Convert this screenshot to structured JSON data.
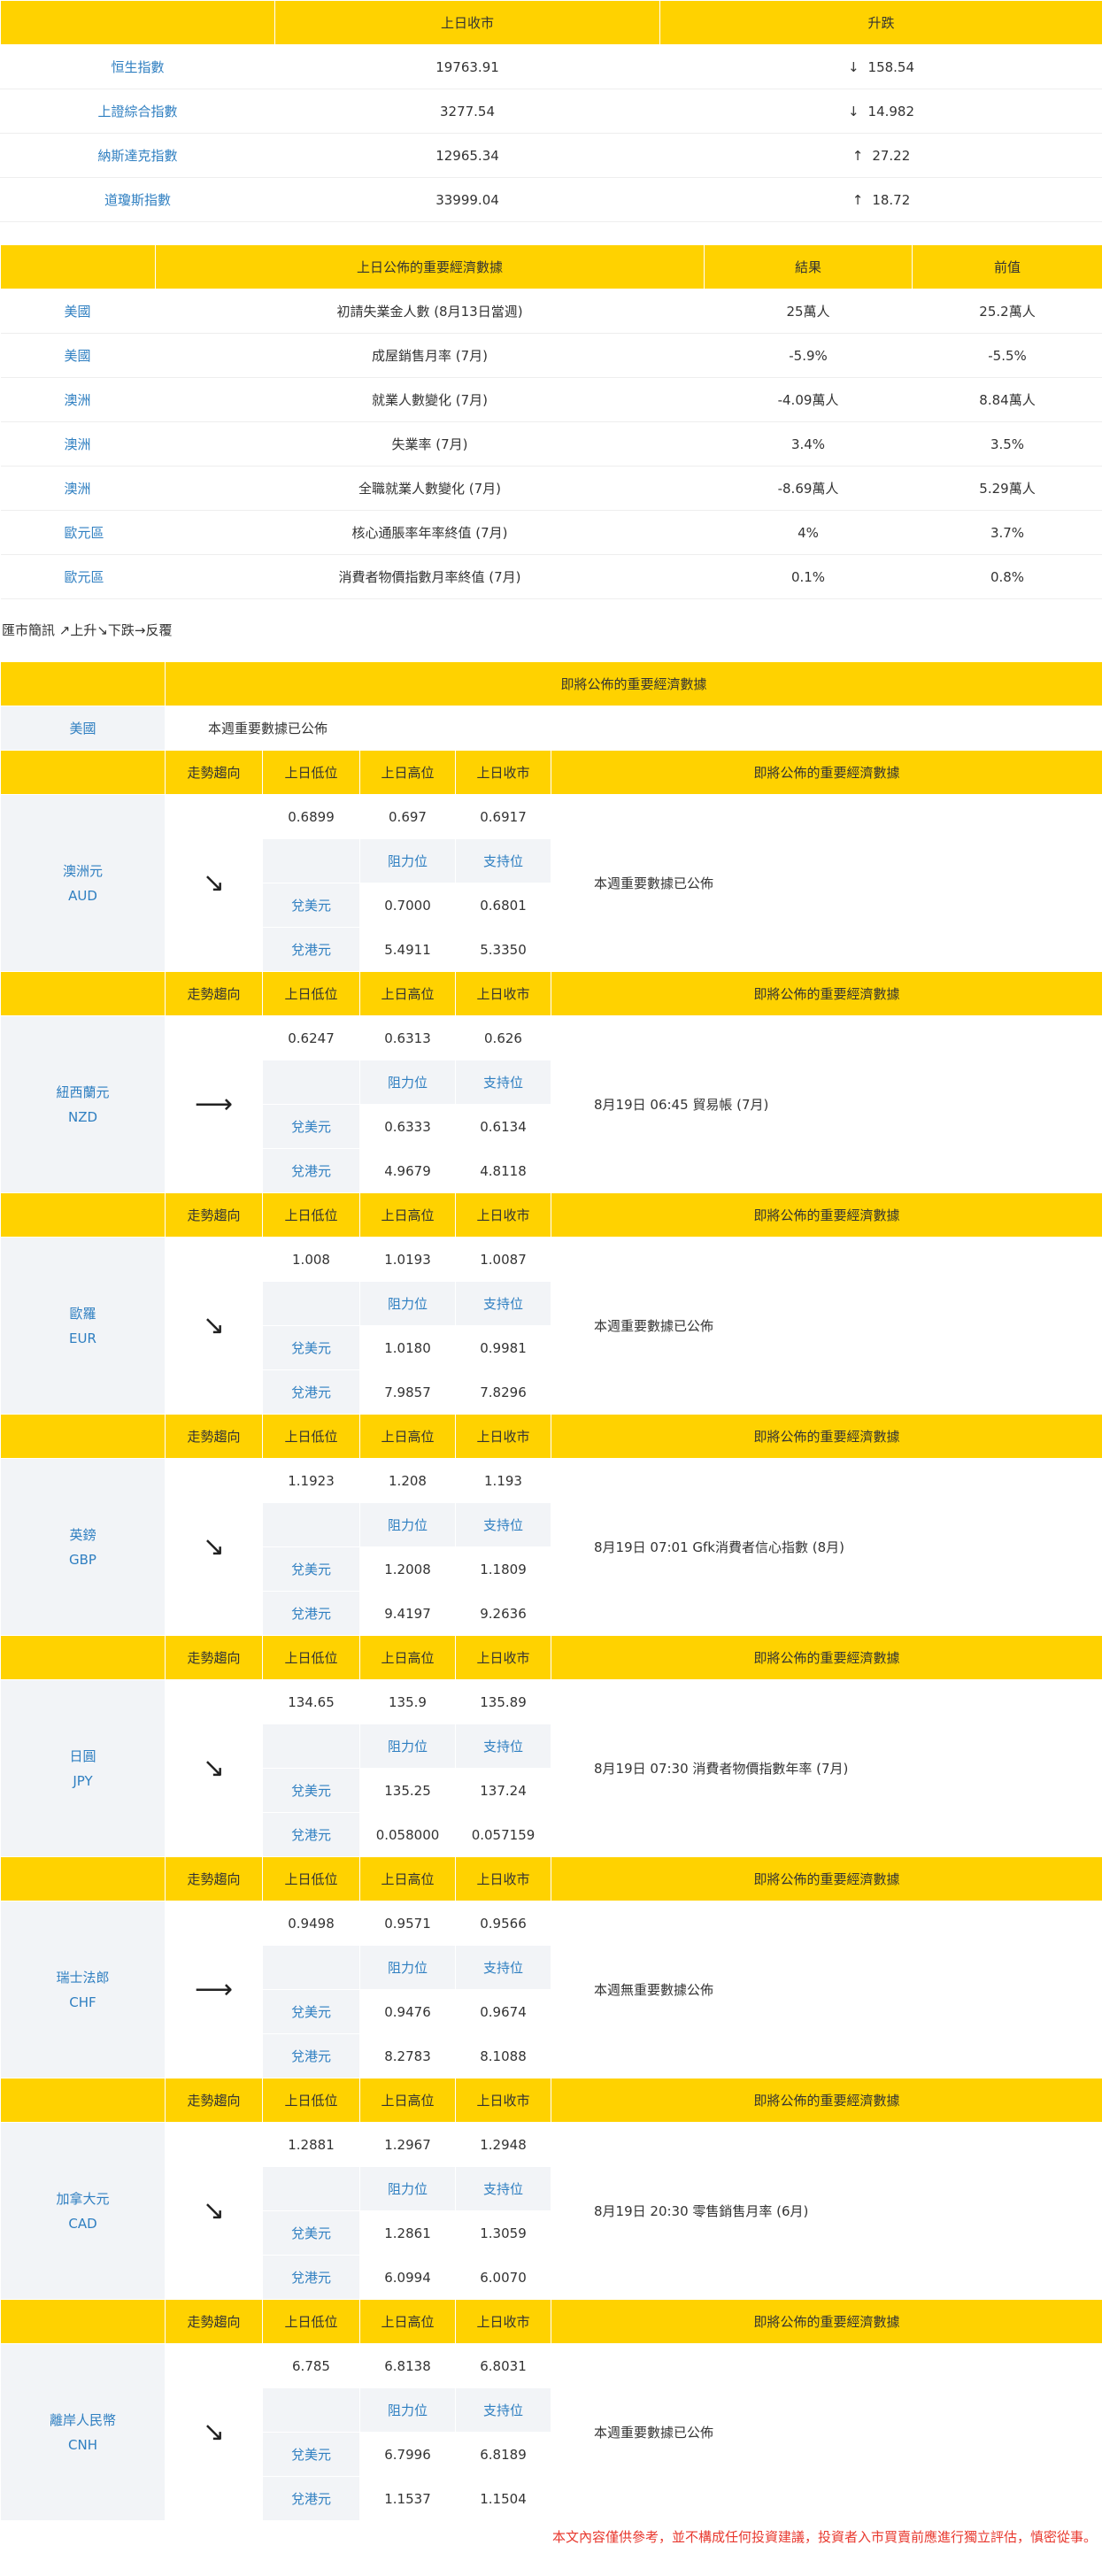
{
  "indices": {
    "headers": [
      "",
      "上日收市",
      "升跌"
    ],
    "rows": [
      {
        "name": "恒生指數",
        "close": "19763.91",
        "arrow": "↓",
        "change": "158.54"
      },
      {
        "name": "上證綜合指數",
        "close": "3277.54",
        "arrow": "↓",
        "change": "14.982"
      },
      {
        "name": "納斯達克指數",
        "close": "12965.34",
        "arrow": "↑",
        "change": "27.22"
      },
      {
        "name": "道瓊斯指數",
        "close": "33999.04",
        "arrow": "↑",
        "change": "18.72"
      }
    ]
  },
  "econ": {
    "headers": [
      "",
      "上日公佈的重要經濟數據",
      "結果",
      "前值"
    ],
    "rows": [
      {
        "region": "美國",
        "item": "初請失業金人數 (8月13日當週)",
        "result": "25萬人",
        "prev": "25.2萬人"
      },
      {
        "region": "美國",
        "item": "成屋銷售月率 (7月)",
        "result": "-5.9%",
        "prev": "-5.5%"
      },
      {
        "region": "澳洲",
        "item": "就業人數變化 (7月)",
        "result": "-4.09萬人",
        "prev": "8.84萬人"
      },
      {
        "region": "澳洲",
        "item": "失業率 (7月)",
        "result": "3.4%",
        "prev": "3.5%"
      },
      {
        "region": "澳洲",
        "item": "全職就業人數變化 (7月)",
        "result": "-8.69萬人",
        "prev": "5.29萬人"
      },
      {
        "region": "歐元區",
        "item": "核心通脹率年率終值 (7月)",
        "result": "4%",
        "prev": "3.7%"
      },
      {
        "region": "歐元區",
        "item": "消費者物價指數月率終值 (7月)",
        "result": "0.1%",
        "prev": "0.8%"
      }
    ]
  },
  "legend": "匯市簡訊 ↗上升↘下跌→反覆",
  "upcoming": {
    "header": "即將公佈的重要經濟數據",
    "us_label": "美國",
    "us_text": "本週重要數據已公佈"
  },
  "fx_headers": {
    "trend": "走勢趨向",
    "low": "上日低位",
    "high": "上日高位",
    "close": "上日收市",
    "upcoming": "即將公佈的重要經濟數據",
    "resistance": "阻力位",
    "support": "支持位",
    "vs_usd": "兌美元",
    "vs_hkd": "兌港元"
  },
  "fx": [
    {
      "name": "澳洲元",
      "code": "AUD",
      "trend": "↘",
      "low": "0.6899",
      "high": "0.697",
      "close": "0.6917",
      "usd_res": "0.7000",
      "usd_sup": "0.6801",
      "hkd_res": "5.4911",
      "hkd_sup": "5.3350",
      "event": "本週重要數據已公佈"
    },
    {
      "name": "紐西蘭元",
      "code": "NZD",
      "trend": "⟶",
      "low": "0.6247",
      "high": "0.6313",
      "close": "0.626",
      "usd_res": "0.6333",
      "usd_sup": "0.6134",
      "hkd_res": "4.9679",
      "hkd_sup": "4.8118",
      "event": "8月19日 06:45 貿易帳 (7月)"
    },
    {
      "name": "歐羅",
      "code": "EUR",
      "trend": "↘",
      "low": "1.008",
      "high": "1.0193",
      "close": "1.0087",
      "usd_res": "1.0180",
      "usd_sup": "0.9981",
      "hkd_res": "7.9857",
      "hkd_sup": "7.8296",
      "event": "本週重要數據已公佈"
    },
    {
      "name": "英鎊",
      "code": "GBP",
      "trend": "↘",
      "low": "1.1923",
      "high": "1.208",
      "close": "1.193",
      "usd_res": "1.2008",
      "usd_sup": "1.1809",
      "hkd_res": "9.4197",
      "hkd_sup": "9.2636",
      "event": "8月19日 07:01 Gfk消費者信心指數 (8月)"
    },
    {
      "name": "日圓",
      "code": "JPY",
      "trend": "↘",
      "low": "134.65",
      "high": "135.9",
      "close": "135.89",
      "usd_res": "135.25",
      "usd_sup": "137.24",
      "hkd_res": "0.058000",
      "hkd_sup": "0.057159",
      "event": "8月19日 07:30 消費者物價指數年率 (7月)"
    },
    {
      "name": "瑞士法郎",
      "code": "CHF",
      "trend": "⟶",
      "low": "0.9498",
      "high": "0.9571",
      "close": "0.9566",
      "usd_res": "0.9476",
      "usd_sup": "0.9674",
      "hkd_res": "8.2783",
      "hkd_sup": "8.1088",
      "event": "本週無重要數據公佈"
    },
    {
      "name": "加拿大元",
      "code": "CAD",
      "trend": "↘",
      "low": "1.2881",
      "high": "1.2967",
      "close": "1.2948",
      "usd_res": "1.2861",
      "usd_sup": "1.3059",
      "hkd_res": "6.0994",
      "hkd_sup": "6.0070",
      "event": "8月19日 20:30 零售銷售月率 (6月)"
    },
    {
      "name": "離岸人民幣",
      "code": "CNH",
      "trend": "↘",
      "low": "6.785",
      "high": "6.8138",
      "close": "6.8031",
      "usd_res": "6.7996",
      "usd_sup": "6.8189",
      "hkd_res": "1.1537",
      "hkd_sup": "1.1504",
      "event": "本週重要數據已公佈"
    }
  ],
  "disclaimer": "本文內容僅供參考，並不構成任何投資建議，投資者入市買賣前應進行獨立評估，慎密從事。"
}
